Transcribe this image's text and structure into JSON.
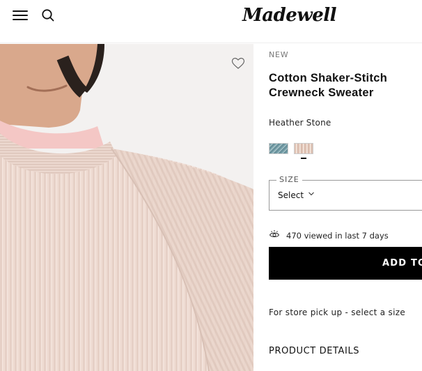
{
  "header": {
    "logo_text": "Madewell",
    "menu_icon": "hamburger-menu-icon",
    "search_icon": "search-icon"
  },
  "gallery": {
    "wishlist_icon": "heart-icon"
  },
  "product": {
    "badge": "NEW",
    "title": "Cotton Shaker-Stitch Crewneck Sweater",
    "color_name": "Heather Stone",
    "swatches": [
      {
        "color": "#7fa8b1",
        "selected": false
      },
      {
        "color": "#e6cfc3",
        "selected": true
      }
    ],
    "size": {
      "label": "SIZE",
      "value": "Select"
    },
    "viewed_text": "470 viewed in last 7 days",
    "add_button_label": "ADD TO BAG",
    "pickup_text": "For store pick up - select a size",
    "details_heading": "PRODUCT DETAILS"
  }
}
